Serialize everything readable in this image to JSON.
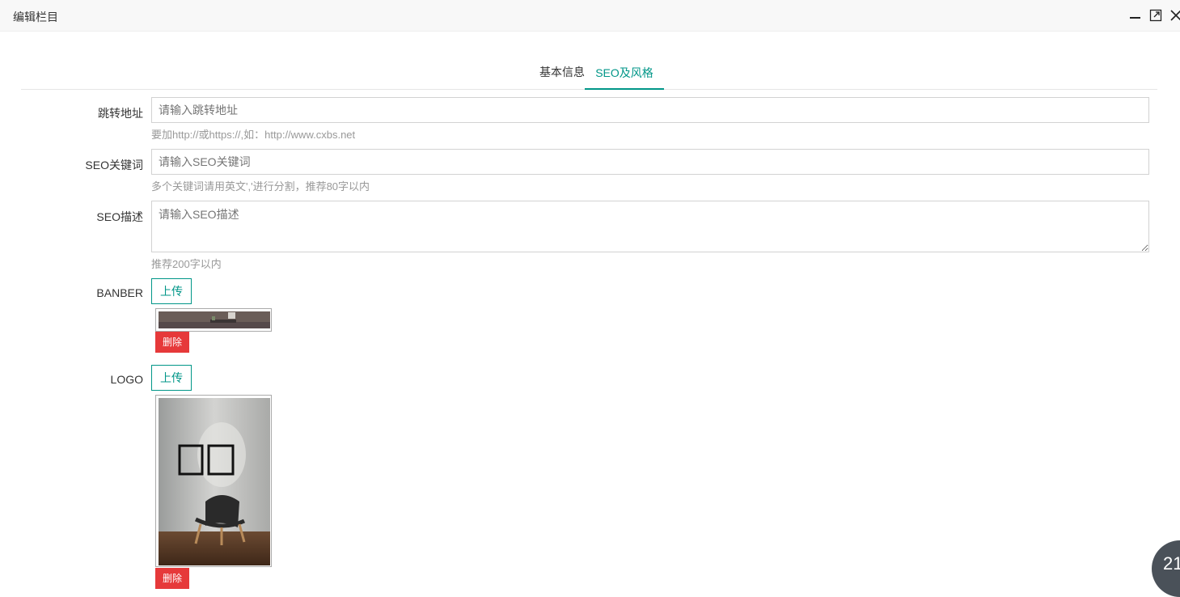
{
  "window": {
    "title": "编辑栏目",
    "controls": [
      "minimize-icon",
      "maximize-icon",
      "close-icon"
    ]
  },
  "tabs": [
    {
      "label": "基本信息",
      "active": false
    },
    {
      "label": "SEO及风格",
      "active": true
    }
  ],
  "form": {
    "redirect": {
      "label": "跳转地址",
      "placeholder": "请输入跳转地址",
      "value": "",
      "hint": "要加http://或https://,如：http://www.cxbs.net"
    },
    "keywords": {
      "label": "SEO关键词",
      "placeholder": "请输入SEO关键词",
      "value": "",
      "hint": "多个关键词请用英文','进行分割，推荐80字以内"
    },
    "description": {
      "label": "SEO描述",
      "placeholder": "请输入SEO描述",
      "value": "",
      "hint": "推荐200字以内"
    },
    "banner": {
      "label": "BANBER",
      "upload_label": "上传",
      "delete_label": "删除"
    },
    "logo": {
      "label": "LOGO",
      "upload_label": "上传",
      "delete_label": "删除"
    }
  },
  "badge": {
    "text": "21"
  },
  "colors": {
    "accent": "#009688",
    "danger": "#e6393a"
  }
}
